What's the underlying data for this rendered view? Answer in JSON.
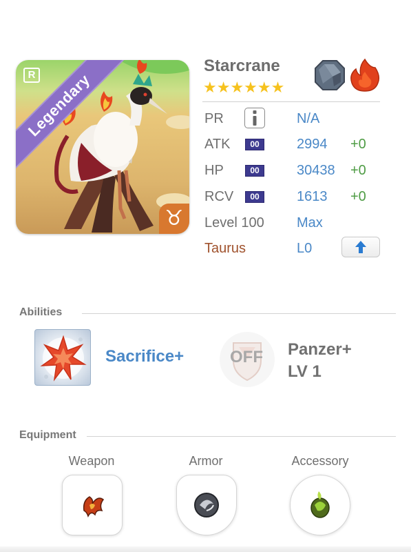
{
  "hero": {
    "name": "Starcrane",
    "rarity_label": "Legendary",
    "rank_badge": "R",
    "zodiac_symbol": "♉",
    "stars": "★★★★★★",
    "star_count": 6,
    "element_icons": [
      "stone-element-icon",
      "fire-element-icon"
    ]
  },
  "stats": {
    "pr": {
      "label": "PR",
      "value": "N/A"
    },
    "atk": {
      "label": "ATK",
      "badge": "00",
      "value": "2994",
      "bonus": "+0"
    },
    "hp": {
      "label": "HP",
      "badge": "00",
      "value": "30438",
      "bonus": "+0"
    },
    "rcv": {
      "label": "RCV",
      "badge": "00",
      "value": "1613",
      "bonus": "+0"
    },
    "level": {
      "label": "Level 100",
      "value": "Max"
    },
    "zodiac": {
      "label": "Taurus",
      "value": "L0"
    }
  },
  "abilities": {
    "title": "Abilities",
    "primary": {
      "name": "Sacrifice+"
    },
    "secondary": {
      "status": "OFF",
      "name_line1": "Panzer+",
      "name_line2": "LV 1"
    }
  },
  "equipment": {
    "title": "Equipment",
    "slots": [
      {
        "label": "Weapon"
      },
      {
        "label": "Armor"
      },
      {
        "label": "Accessory"
      }
    ]
  },
  "colors": {
    "accent_blue": "#4a88c7",
    "bonus_green": "#4f9c45",
    "zodiac_brown": "#a0522d",
    "legendary_purple": "#8b6fc7",
    "star_gold": "#f6c21e"
  }
}
